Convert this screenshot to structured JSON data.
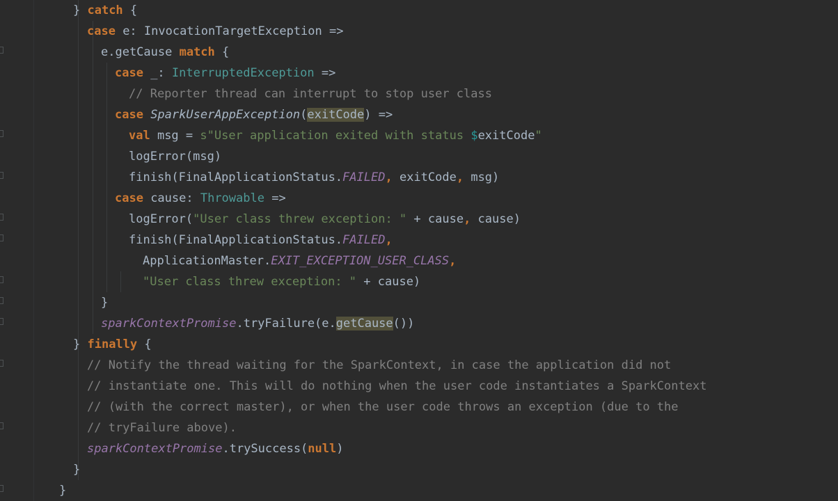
{
  "editor": {
    "language": "Scala",
    "colors": {
      "background": "#2b2b2b",
      "default": "#a9b7c6",
      "keyword": "#cc7832",
      "string": "#6a8759",
      "comment": "#808080",
      "type": "#4e9a97",
      "field": "#9876aa",
      "interpolation": "#299999",
      "highlight": "#52503a"
    },
    "lines": [
      {
        "indent": 2,
        "tokens": [
          {
            "t": "} ",
            "c": ""
          },
          {
            "t": "catch",
            "c": "kw"
          },
          {
            "t": " {",
            "c": ""
          }
        ]
      },
      {
        "indent": 3,
        "tokens": [
          {
            "t": "case ",
            "c": "kw"
          },
          {
            "t": "e: InvocationTargetException =>",
            "c": ""
          }
        ]
      },
      {
        "indent": 4,
        "tokens": [
          {
            "t": "e.getCause ",
            "c": ""
          },
          {
            "t": "match",
            "c": "kw"
          },
          {
            "t": " {",
            "c": ""
          }
        ]
      },
      {
        "indent": 5,
        "tokens": [
          {
            "t": "case ",
            "c": "kw"
          },
          {
            "t": "_: ",
            "c": ""
          },
          {
            "t": "InterruptedException",
            "c": "typ"
          },
          {
            "t": " =>",
            "c": ""
          }
        ]
      },
      {
        "indent": 6,
        "tokens": [
          {
            "t": "// Reporter thread can interrupt to stop user class",
            "c": "cmt"
          }
        ]
      },
      {
        "indent": 5,
        "tokens": [
          {
            "t": "case ",
            "c": "kw"
          },
          {
            "t": "SparkUserAppException",
            "c": "cls"
          },
          {
            "t": "(",
            "c": ""
          },
          {
            "t": "exitCode",
            "c": "hl"
          },
          {
            "t": ") =>",
            "c": ""
          }
        ]
      },
      {
        "indent": 6,
        "tokens": [
          {
            "t": "val ",
            "c": "kw"
          },
          {
            "t": "msg = ",
            "c": ""
          },
          {
            "t": "s\"User application exited with status ",
            "c": "str"
          },
          {
            "t": "$",
            "c": "interp"
          },
          {
            "t": "exitCode",
            "c": ""
          },
          {
            "t": "\"",
            "c": "str"
          }
        ]
      },
      {
        "indent": 6,
        "tokens": [
          {
            "t": "logError(msg)",
            "c": ""
          }
        ]
      },
      {
        "indent": 6,
        "tokens": [
          {
            "t": "finish(FinalApplicationStatus.",
            "c": ""
          },
          {
            "t": "FAILED",
            "c": "fld"
          },
          {
            "t": ", ",
            "c": "kw"
          },
          {
            "t": "exitCode",
            "c": ""
          },
          {
            "t": ", ",
            "c": "kw"
          },
          {
            "t": "msg)",
            "c": ""
          }
        ]
      },
      {
        "indent": 5,
        "tokens": [
          {
            "t": "case ",
            "c": "kw"
          },
          {
            "t": "cause: ",
            "c": ""
          },
          {
            "t": "Throwable",
            "c": "typ"
          },
          {
            "t": " =>",
            "c": ""
          }
        ]
      },
      {
        "indent": 6,
        "tokens": [
          {
            "t": "logError(",
            "c": ""
          },
          {
            "t": "\"User class threw exception: \"",
            "c": "str"
          },
          {
            "t": " + cause",
            "c": ""
          },
          {
            "t": ", ",
            "c": "kw"
          },
          {
            "t": "cause)",
            "c": ""
          }
        ]
      },
      {
        "indent": 6,
        "tokens": [
          {
            "t": "finish(FinalApplicationStatus.",
            "c": ""
          },
          {
            "t": "FAILED",
            "c": "fld"
          },
          {
            "t": ",",
            "c": "kw"
          }
        ]
      },
      {
        "indent": 7,
        "tokens": [
          {
            "t": "ApplicationMaster.",
            "c": ""
          },
          {
            "t": "EXIT_EXCEPTION_USER_CLASS",
            "c": "fld"
          },
          {
            "t": ",",
            "c": "kw"
          }
        ]
      },
      {
        "indent": 7,
        "tokens": [
          {
            "t": "\"User class threw exception: \"",
            "c": "str"
          },
          {
            "t": " + cause)",
            "c": ""
          }
        ]
      },
      {
        "indent": 4,
        "tokens": [
          {
            "t": "}",
            "c": ""
          }
        ]
      },
      {
        "indent": 4,
        "tokens": [
          {
            "t": "sparkContextPromise",
            "c": "fld"
          },
          {
            "t": ".tryFailure(e.",
            "c": ""
          },
          {
            "t": "getCause",
            "c": "hl"
          },
          {
            "t": "())",
            "c": ""
          }
        ]
      },
      {
        "indent": 2,
        "tokens": [
          {
            "t": "} ",
            "c": ""
          },
          {
            "t": "finally",
            "c": "kw"
          },
          {
            "t": " {",
            "c": ""
          }
        ]
      },
      {
        "indent": 3,
        "tokens": [
          {
            "t": "// Notify the thread waiting for the SparkContext, in case the application did not",
            "c": "cmt"
          }
        ]
      },
      {
        "indent": 3,
        "tokens": [
          {
            "t": "// instantiate one. This will do nothing when the user code instantiates a SparkContext",
            "c": "cmt"
          }
        ]
      },
      {
        "indent": 3,
        "tokens": [
          {
            "t": "// (with the correct master), or when the user code throws an exception (due to the",
            "c": "cmt"
          }
        ]
      },
      {
        "indent": 3,
        "tokens": [
          {
            "t": "// tryFailure above).",
            "c": "cmt"
          }
        ]
      },
      {
        "indent": 3,
        "tokens": [
          {
            "t": "sparkContextPromise",
            "c": "fld"
          },
          {
            "t": ".trySuccess(",
            "c": ""
          },
          {
            "t": "null",
            "c": "kw"
          },
          {
            "t": ")",
            "c": ""
          }
        ]
      },
      {
        "indent": 2,
        "tokens": [
          {
            "t": "}",
            "c": ""
          }
        ]
      },
      {
        "indent": 1,
        "tokens": [
          {
            "t": "}",
            "c": ""
          }
        ]
      }
    ]
  }
}
